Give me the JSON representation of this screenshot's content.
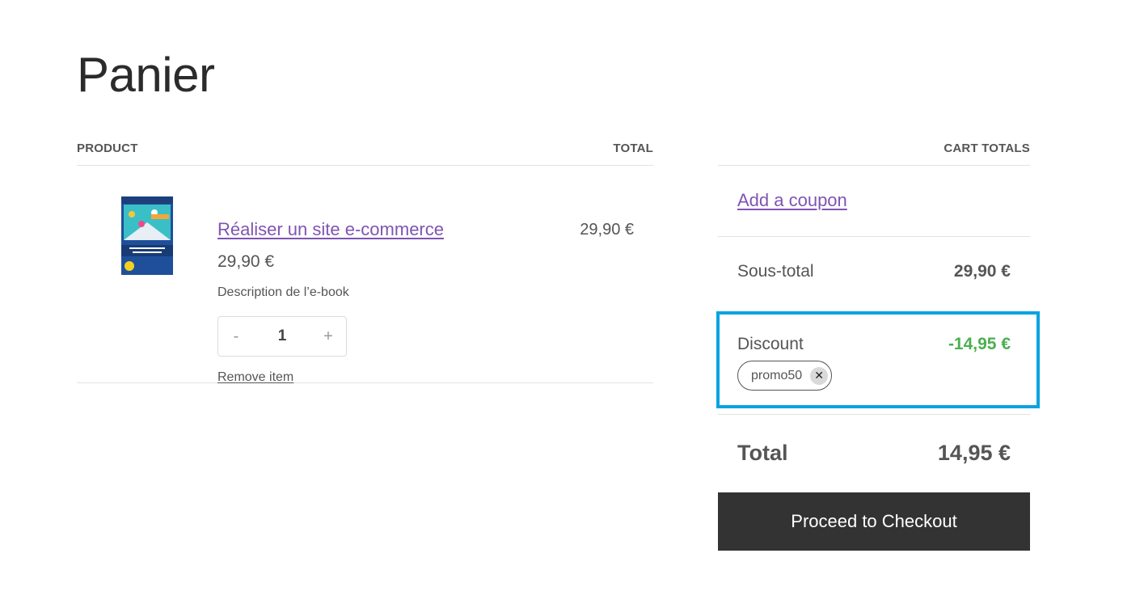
{
  "page": {
    "title": "Panier"
  },
  "cart_table": {
    "headers": {
      "product": "PRODUCT",
      "total": "TOTAL"
    },
    "items": [
      {
        "name": "Réaliser un site e-commerce",
        "price": "29,90 €",
        "description": "Description de l’e-book",
        "quantity": "1",
        "minus_label": "-",
        "plus_label": "+",
        "remove_label": "Remove item",
        "line_total": "29,90 €",
        "thumbnail_icon": "ebook-cover-image"
      }
    ]
  },
  "cart_totals": {
    "heading": "CART TOTALS",
    "coupon_link": "Add a coupon",
    "subtotal_label": "Sous-total",
    "subtotal_value": "29,90 €",
    "discount_label": "Discount",
    "discount_value": "-14,95 €",
    "coupon_code": "promo50",
    "coupon_remove_icon": "close-icon",
    "total_label": "Total",
    "total_value": "14,95 €",
    "checkout_label": "Proceed to Checkout"
  },
  "colors": {
    "link": "#7f54b3",
    "discount": "#4caf50",
    "highlight_border": "#0aa3e0",
    "checkout_bg": "#333333"
  }
}
